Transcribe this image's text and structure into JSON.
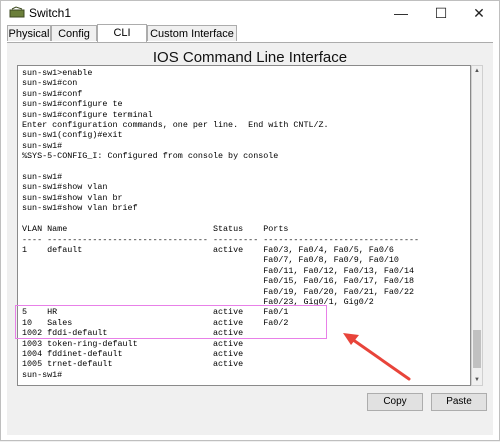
{
  "window": {
    "title": "Switch1"
  },
  "controls": {
    "minimize": "—",
    "maximize": "☐",
    "close": "✕"
  },
  "tabs": [
    "Physical",
    "Config",
    "CLI",
    "Custom Interface"
  ],
  "panel": {
    "heading": "IOS Command Line Interface"
  },
  "terminal": {
    "lines": "sun-sw1>enable\nsun-sw1#con\nsun-sw1#conf\nsun-sw1#configure te\nsun-sw1#configure terminal\nEnter configuration commands, one per line.  End with CNTL/Z.\nsun-sw1(config)#exit\nsun-sw1#\n%SYS-5-CONFIG_I: Configured from console by console\n\nsun-sw1#\nsun-sw1#show vlan\nsun-sw1#show vlan br\nsun-sw1#show vlan brief\n\nVLAN Name                             Status    Ports\n---- -------------------------------- --------- -------------------------------\n1    default                          active    Fa0/3, Fa0/4, Fa0/5, Fa0/6\n                                                Fa0/7, Fa0/8, Fa0/9, Fa0/10\n                                                Fa0/11, Fa0/12, Fa0/13, Fa0/14\n                                                Fa0/15, Fa0/16, Fa0/17, Fa0/18\n                                                Fa0/19, Fa0/20, Fa0/21, Fa0/22\n                                                Fa0/23, Gig0/1, Gig0/2\n5    HR                               active    Fa0/1\n10   Sales                            active    Fa0/2\n1002 fddi-default                     active\n1003 token-ring-default               active\n1004 fddinet-default                  active\n1005 trnet-default                    active\nsun-sw1#"
  },
  "buttons": {
    "copy": "Copy",
    "paste": "Paste"
  },
  "colors": {
    "highlight": "#e880e8",
    "arrow": "#e8443a"
  }
}
